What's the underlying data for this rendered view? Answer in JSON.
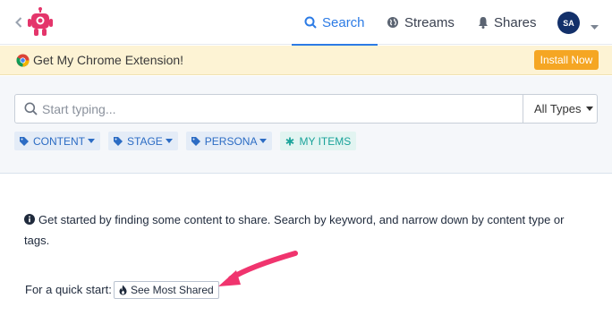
{
  "nav": {
    "search_label": "Search",
    "streams_label": "Streams",
    "shares_label": "Shares",
    "avatar_initials": "SA"
  },
  "banner": {
    "text": "Get My Chrome Extension!",
    "install_label": "Install Now"
  },
  "search": {
    "placeholder": "Start typing...",
    "value": "",
    "type_label": "All Types"
  },
  "filters": [
    {
      "label": "CONTENT"
    },
    {
      "label": "STAGE"
    },
    {
      "label": "PERSONA"
    },
    {
      "label": "MY ITEMS"
    }
  ],
  "content": {
    "info_text": "Get started by finding some content to share. Search by keyword, and narrow down by content type or tags.",
    "quick_start_label": "For a quick start:",
    "most_shared_label": "See Most Shared"
  },
  "colors": {
    "accent": "#2c7be5",
    "install": "#f5a623",
    "banner_bg": "#fdf3d4",
    "avatar_bg": "#13306a",
    "tag_bg": "#e4ecf7",
    "tag_mine": "#1aa39a",
    "arrow": "#f0346e",
    "logo": "#e4356b"
  },
  "icons": {
    "back": "chevron-left-icon",
    "search": "magnifier-icon",
    "streams": "globe-icon",
    "shares": "bell-icon",
    "tag": "tag-icon",
    "mine": "asterisk-icon",
    "info": "info-circle-icon",
    "most_shared": "fire-icon"
  }
}
